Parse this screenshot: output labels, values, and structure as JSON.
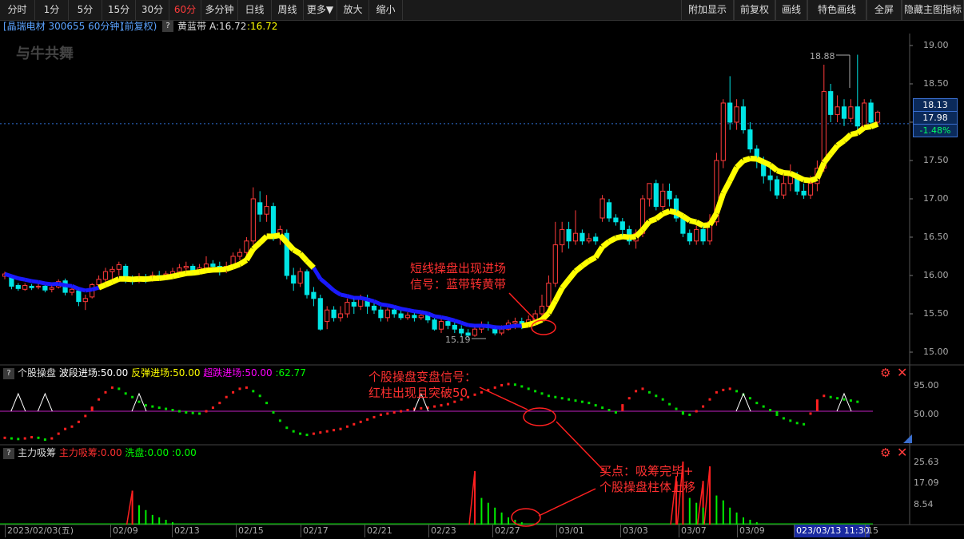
{
  "toolbar": {
    "left": [
      "分时",
      "1分",
      "5分",
      "15分",
      "30分",
      "60分",
      "多分钟",
      "日线",
      "周线",
      "更多▼",
      "放大",
      "缩小"
    ],
    "active_index": 5,
    "right": [
      "附加显示",
      "前复权",
      "画线",
      "特色画线",
      "全屏",
      "隐藏主图指标"
    ]
  },
  "header": {
    "stock": "[晶瑞电材 300655 60分钟]",
    "adj": "(前复权)",
    "help": "?",
    "indicator": "黄蓝带",
    "a_label": "A:16.72",
    "a_value": ":16.72"
  },
  "watermark": "与牛共舞",
  "price_axis": {
    "min": 15.0,
    "max": 19.0,
    "ticks": [
      "19.00",
      "18.50",
      "18.00",
      "17.50",
      "17.00",
      "16.50",
      "16.00",
      "15.50",
      "15.00"
    ],
    "high_label": "18.88",
    "low_label": "15.19",
    "current_price": "18.13",
    "ref_price": "17.98",
    "change_pct": "-1.48%"
  },
  "panel2": {
    "help": "?",
    "name": "个股操盘",
    "items": [
      "波段进场:50.00",
      "反弹进场:50.00",
      "超跌进场:50.00",
      ":62.77"
    ],
    "colors": [
      "#ffffff",
      "#ffff00",
      "#ff00ff",
      "#00ff00"
    ],
    "axis": [
      "95.00",
      "50.00"
    ],
    "threshold": 50
  },
  "panel3": {
    "help": "?",
    "name": "主力吸筹",
    "items": [
      "主力吸筹:0.00",
      "洗盘:0.00",
      ":0.00"
    ],
    "colors": [
      "#ff3030",
      "#00ff00",
      "#00ff00"
    ],
    "axis": [
      "25.63",
      "17.09",
      "8.54"
    ]
  },
  "time_axis": {
    "labels": [
      "2023/02/03(五)",
      "02/09",
      "02/13",
      "02/15",
      "02/17",
      "02/21",
      "02/23",
      "02/27",
      "03/01",
      "03/03",
      "03/07",
      "03/09",
      "023/03/13 11:30",
      "15"
    ]
  },
  "annotations": {
    "a1": "短线操盘出现进场\n信号：蓝带转黄带",
    "a2": "个股操盘变盘信号：\n红柱出现且突破50",
    "a3": "买点：吸筹完毕+\n个股操盘柱体上移"
  },
  "colors": {
    "up": "#ff3b3b",
    "down": "#00e5e5",
    "blue_band": "#1a1aff",
    "yellow_band": "#ffff00",
    "annotation": "#ff2020",
    "ref_line": "#2f6fd6"
  },
  "chart_data": {
    "type": "candlestick",
    "ylim": [
      15.0,
      19.0
    ],
    "candles": [
      [
        15.99,
        16.02,
        15.95,
        16.05
      ],
      [
        15.98,
        15.86,
        15.82,
        16.0
      ],
      [
        15.87,
        15.83,
        15.8,
        15.9
      ],
      [
        15.82,
        15.87,
        15.8,
        15.9
      ],
      [
        15.86,
        15.84,
        15.81,
        15.89
      ],
      [
        15.85,
        15.86,
        15.82,
        15.9
      ],
      [
        15.86,
        15.81,
        15.78,
        15.88
      ],
      [
        15.82,
        15.84,
        15.78,
        15.88
      ],
      [
        15.85,
        15.92,
        15.83,
        15.95
      ],
      [
        15.93,
        15.78,
        15.74,
        15.96
      ],
      [
        15.78,
        15.82,
        15.74,
        15.85
      ],
      [
        15.8,
        15.66,
        15.6,
        15.84
      ],
      [
        15.66,
        15.7,
        15.55,
        15.75
      ],
      [
        15.72,
        15.88,
        15.7,
        15.9
      ],
      [
        15.88,
        15.95,
        15.85,
        16.0
      ],
      [
        15.95,
        16.05,
        15.9,
        16.1
      ],
      [
        16.05,
        16.08,
        15.95,
        16.12
      ],
      [
        16.08,
        16.14,
        16.0,
        16.18
      ],
      [
        16.12,
        15.96,
        15.9,
        16.15
      ],
      [
        15.95,
        15.92,
        15.88,
        16.0
      ],
      [
        15.93,
        15.98,
        15.9,
        16.03
      ],
      [
        15.98,
        15.94,
        15.9,
        16.02
      ],
      [
        15.95,
        16.0,
        15.92,
        16.05
      ],
      [
        16.0,
        15.98,
        15.95,
        16.06
      ],
      [
        15.98,
        16.02,
        15.95,
        16.06
      ],
      [
        16.02,
        16.05,
        15.98,
        16.1
      ],
      [
        16.05,
        16.1,
        16.0,
        16.15
      ],
      [
        16.1,
        16.12,
        16.05,
        16.18
      ],
      [
        16.12,
        16.06,
        16.0,
        16.15
      ],
      [
        16.05,
        16.1,
        16.02,
        16.15
      ],
      [
        16.1,
        16.15,
        16.05,
        16.25
      ],
      [
        16.15,
        16.12,
        16.05,
        16.2
      ],
      [
        16.12,
        16.08,
        16.0,
        16.18
      ],
      [
        16.08,
        16.12,
        16.03,
        16.18
      ],
      [
        16.12,
        16.25,
        16.1,
        16.3
      ],
      [
        16.25,
        16.3,
        16.2,
        16.35
      ],
      [
        16.3,
        16.45,
        16.25,
        16.5
      ],
      [
        16.45,
        17.0,
        16.4,
        17.15
      ],
      [
        16.95,
        16.8,
        16.7,
        17.1
      ],
      [
        16.8,
        16.9,
        16.7,
        17.05
      ],
      [
        16.9,
        16.5,
        16.45,
        16.95
      ],
      [
        16.5,
        16.6,
        16.4,
        16.65
      ],
      [
        16.55,
        16.0,
        15.95,
        16.6
      ],
      [
        16.0,
        15.9,
        15.8,
        16.1
      ],
      [
        15.9,
        16.05,
        15.85,
        16.1
      ],
      [
        16.05,
        15.75,
        15.7,
        16.08
      ],
      [
        15.78,
        15.7,
        15.6,
        15.85
      ],
      [
        15.7,
        15.3,
        15.28,
        15.75
      ],
      [
        15.4,
        15.55,
        15.3,
        15.6
      ],
      [
        15.55,
        15.45,
        15.4,
        15.6
      ],
      [
        15.45,
        15.5,
        15.4,
        15.6
      ],
      [
        15.5,
        15.65,
        15.45,
        15.7
      ],
      [
        15.65,
        15.6,
        15.5,
        15.72
      ],
      [
        15.6,
        15.7,
        15.55,
        15.75
      ],
      [
        15.7,
        15.6,
        15.5,
        15.75
      ],
      [
        15.6,
        15.55,
        15.5,
        15.65
      ],
      [
        15.55,
        15.45,
        15.4,
        15.6
      ],
      [
        15.45,
        15.55,
        15.4,
        15.58
      ],
      [
        15.55,
        15.5,
        15.45,
        15.6
      ],
      [
        15.5,
        15.45,
        15.42,
        15.55
      ],
      [
        15.45,
        15.48,
        15.42,
        15.52
      ],
      [
        15.48,
        15.45,
        15.4,
        15.52
      ],
      [
        15.45,
        15.48,
        15.42,
        15.5
      ],
      [
        15.48,
        15.42,
        15.38,
        15.5
      ],
      [
        15.42,
        15.3,
        15.28,
        15.45
      ],
      [
        15.3,
        15.4,
        15.25,
        15.45
      ],
      [
        15.4,
        15.35,
        15.3,
        15.45
      ],
      [
        15.35,
        15.3,
        15.25,
        15.4
      ],
      [
        15.3,
        15.25,
        15.2,
        15.35
      ],
      [
        15.25,
        15.22,
        15.19,
        15.3
      ],
      [
        15.22,
        15.3,
        15.2,
        15.35
      ],
      [
        15.3,
        15.35,
        15.25,
        15.4
      ],
      [
        15.35,
        15.32,
        15.28,
        15.4
      ],
      [
        15.32,
        15.25,
        15.22,
        15.35
      ],
      [
        15.25,
        15.3,
        15.22,
        15.35
      ],
      [
        15.3,
        15.38,
        15.28,
        15.42
      ],
      [
        15.38,
        15.4,
        15.3,
        15.45
      ],
      [
        15.4,
        15.35,
        15.3,
        15.45
      ],
      [
        15.35,
        15.42,
        15.33,
        15.48
      ],
      [
        15.42,
        15.5,
        15.4,
        15.55
      ],
      [
        15.5,
        15.6,
        15.45,
        15.75
      ],
      [
        15.6,
        15.9,
        15.55,
        16.0
      ],
      [
        15.9,
        16.4,
        15.85,
        16.7
      ],
      [
        16.4,
        16.6,
        16.3,
        16.7
      ],
      [
        16.6,
        16.45,
        16.35,
        16.7
      ],
      [
        16.45,
        16.55,
        16.4,
        16.85
      ],
      [
        16.55,
        16.45,
        16.4,
        16.6
      ],
      [
        16.45,
        16.48,
        16.42,
        16.55
      ],
      [
        16.5,
        16.45,
        16.4,
        16.55
      ],
      [
        16.75,
        17.0,
        16.7,
        17.05
      ],
      [
        16.95,
        16.75,
        16.7,
        17.0
      ],
      [
        16.75,
        16.7,
        16.65,
        16.8
      ],
      [
        16.7,
        16.6,
        16.5,
        16.75
      ],
      [
        16.6,
        16.45,
        16.4,
        16.65
      ],
      [
        16.45,
        16.55,
        16.35,
        16.6
      ],
      [
        16.55,
        17.0,
        16.5,
        17.05
      ],
      [
        17.0,
        17.2,
        16.9,
        17.2
      ],
      [
        17.2,
        16.9,
        16.85,
        17.25
      ],
      [
        16.9,
        17.1,
        16.85,
        17.2
      ],
      [
        17.1,
        17.0,
        16.9,
        17.2
      ],
      [
        17.0,
        16.75,
        16.7,
        17.05
      ],
      [
        16.75,
        16.55,
        16.5,
        16.8
      ],
      [
        16.55,
        16.45,
        16.4,
        16.6
      ],
      [
        16.45,
        16.6,
        16.4,
        16.65
      ],
      [
        16.6,
        16.45,
        16.4,
        16.65
      ],
      [
        16.45,
        16.7,
        16.4,
        16.8
      ],
      [
        16.7,
        17.5,
        16.65,
        17.6
      ],
      [
        17.5,
        18.25,
        17.4,
        18.3
      ],
      [
        18.25,
        18.0,
        17.9,
        18.6
      ],
      [
        18.0,
        18.2,
        17.9,
        18.3
      ],
      [
        18.2,
        17.9,
        17.85,
        18.3
      ],
      [
        17.9,
        17.65,
        17.6,
        18.0
      ],
      [
        17.65,
        17.5,
        17.4,
        17.7
      ],
      [
        17.5,
        17.3,
        17.2,
        17.55
      ],
      [
        17.3,
        17.25,
        17.1,
        17.4
      ],
      [
        17.25,
        17.05,
        17.0,
        17.3
      ],
      [
        17.05,
        17.2,
        17.0,
        17.3
      ],
      [
        17.2,
        17.3,
        17.1,
        17.45
      ],
      [
        17.3,
        17.1,
        17.05,
        17.35
      ],
      [
        17.1,
        17.05,
        17.0,
        17.2
      ],
      [
        17.05,
        17.2,
        17.0,
        17.3
      ],
      [
        17.2,
        17.4,
        17.1,
        17.5
      ],
      [
        17.4,
        18.4,
        17.35,
        18.75
      ],
      [
        18.4,
        18.1,
        18.0,
        18.5
      ],
      [
        18.1,
        18.2,
        18.0,
        18.35
      ],
      [
        18.2,
        18.05,
        17.95,
        18.3
      ],
      [
        18.05,
        18.2,
        18.0,
        18.3
      ],
      [
        18.2,
        17.95,
        17.9,
        18.88
      ],
      [
        17.95,
        18.25,
        17.9,
        18.3
      ],
      [
        18.25,
        18.0,
        17.95,
        18.3
      ],
      [
        18.0,
        18.13,
        17.95,
        18.15
      ]
    ],
    "yellow_x": [
      [
        0,
        0
      ],
      [
        15,
        46
      ],
      [
        78,
        200
      ]
    ],
    "wave": [
      5,
      4,
      3,
      4,
      6,
      5,
      2,
      4,
      12,
      20,
      24,
      32,
      42,
      56,
      70,
      82,
      90,
      88,
      80,
      74,
      66,
      60,
      58,
      56,
      54,
      52,
      50,
      48,
      47,
      46,
      50,
      56,
      64,
      74,
      82,
      88,
      90,
      84,
      76,
      64,
      48,
      34,
      22,
      16,
      12,
      10,
      12,
      14,
      16,
      18,
      20,
      24,
      28,
      32,
      36,
      40,
      44,
      46,
      48,
      50,
      52,
      54,
      55,
      56,
      58,
      60,
      62,
      66,
      70,
      74,
      78,
      82,
      86,
      90,
      94,
      96,
      95,
      92,
      88,
      84,
      80,
      76,
      74,
      72,
      70,
      68,
      66,
      64,
      60,
      56,
      52,
      48,
      60,
      72,
      84,
      88,
      82,
      76,
      70,
      62,
      54,
      46,
      44,
      50,
      58,
      70,
      82,
      86,
      88,
      84,
      78,
      72,
      64,
      58,
      52,
      44,
      38,
      34,
      30,
      28,
      46,
      68,
      76,
      74,
      72,
      70,
      68,
      66
    ],
    "triangles": [
      2,
      6,
      20,
      62,
      110,
      125,
      145,
      168
    ],
    "accum": [
      0,
      0,
      0,
      0,
      0,
      0,
      0,
      0,
      0,
      0,
      0,
      0,
      0,
      0,
      0,
      0,
      0,
      0,
      0,
      14,
      0,
      0,
      0,
      0,
      0,
      0,
      0,
      0,
      0,
      0,
      0,
      0,
      0,
      0,
      0,
      0,
      0,
      0,
      0,
      0,
      0,
      0,
      0,
      0,
      0,
      0,
      0,
      0,
      0,
      0,
      0,
      0,
      0,
      0,
      0,
      0,
      0,
      0,
      0,
      0,
      0,
      0,
      0,
      0,
      0,
      0,
      0,
      0,
      0,
      0,
      22,
      0,
      0,
      0,
      0,
      0,
      0,
      0,
      0,
      0,
      0,
      0,
      0,
      0,
      0,
      0,
      0,
      0,
      0,
      0,
      0,
      0,
      0,
      0,
      0,
      0,
      0,
      0,
      0,
      0,
      20,
      26,
      0,
      0,
      18,
      24,
      0,
      0,
      0,
      0,
      0,
      0,
      0,
      0,
      0,
      0,
      0,
      0,
      0,
      0,
      0,
      0,
      0,
      0,
      0,
      0,
      0,
      0,
      0,
      0,
      0,
      0,
      0,
      0,
      0,
      0,
      0
    ],
    "wash": [
      0,
      0,
      0,
      0,
      0,
      0,
      0,
      0,
      0,
      0,
      0,
      0,
      0,
      0,
      0,
      0,
      0,
      0,
      0,
      0,
      8,
      6,
      4,
      3,
      2,
      1,
      0,
      0,
      0,
      0,
      0,
      0,
      0,
      0,
      0,
      0,
      0,
      0,
      0,
      0,
      0,
      0,
      0,
      0,
      0,
      0,
      0,
      0,
      0,
      0,
      0,
      0,
      0,
      0,
      0,
      0,
      0,
      0,
      0,
      0,
      0,
      0,
      0,
      0,
      0,
      0,
      0,
      0,
      0,
      0,
      0,
      11,
      9,
      7,
      5,
      3,
      2,
      1,
      0,
      0,
      0,
      0,
      0,
      0,
      0,
      0,
      0,
      0,
      0,
      0,
      0,
      0,
      0,
      0,
      0,
      0,
      0,
      0,
      0,
      0,
      0,
      0,
      11,
      9,
      7,
      0,
      12,
      10,
      7,
      5,
      3,
      2,
      1,
      0,
      0,
      0,
      0,
      0,
      0,
      0,
      0,
      0,
      0,
      0,
      0,
      0,
      0,
      0,
      0,
      0,
      0,
      0,
      0,
      0,
      0,
      0,
      0
    ]
  }
}
